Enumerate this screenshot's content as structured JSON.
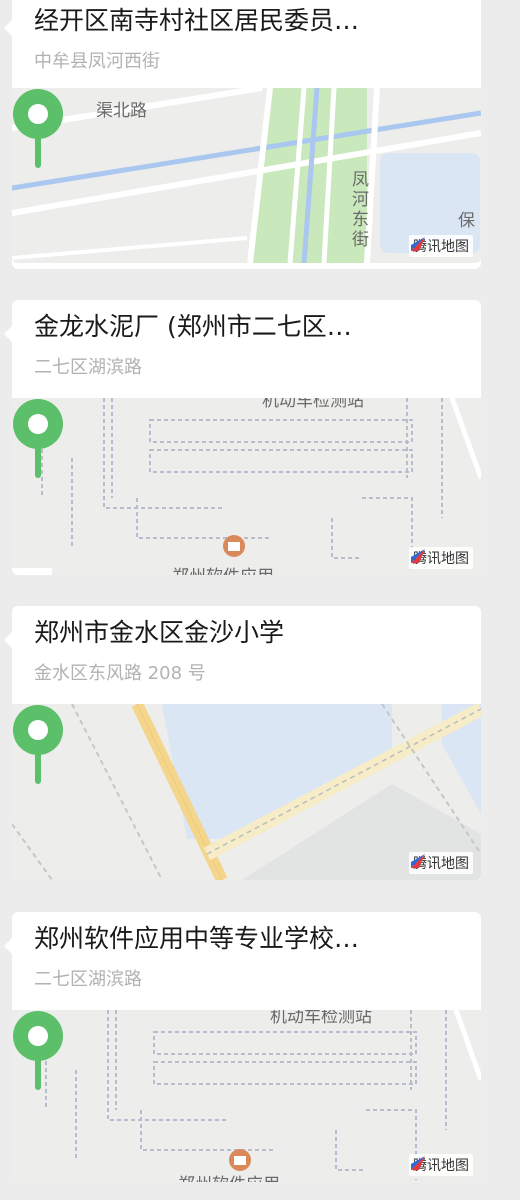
{
  "map_watermark": "腾讯地图",
  "colors": {
    "pin": "#5cbf6a",
    "accent_road_yellow": "#f4d58c",
    "water": "#dbe6f5"
  },
  "icons": {
    "location_pin": "map-pin-icon",
    "watermark_logo": "tencent-map-logo-icon"
  },
  "cards": [
    {
      "title": "经开区南寺村社区居民委员…",
      "subtitle": "中牟县凤河西街",
      "map_labels": [
        "渠北路",
        "凤河东街",
        "保"
      ]
    },
    {
      "title": "金龙水泥厂 (郑州市二七区…",
      "subtitle": "二七区湖滨路",
      "map_labels": [
        "机动车检测站",
        "郑州软件应用"
      ]
    },
    {
      "title": "郑州市金水区金沙小学",
      "subtitle": "金水区东风路 208 号",
      "map_labels": []
    },
    {
      "title": "郑州软件应用中等专业学校…",
      "subtitle": "二七区湖滨路",
      "map_labels": [
        "机动车检测站",
        "郑州软件应用"
      ]
    }
  ]
}
